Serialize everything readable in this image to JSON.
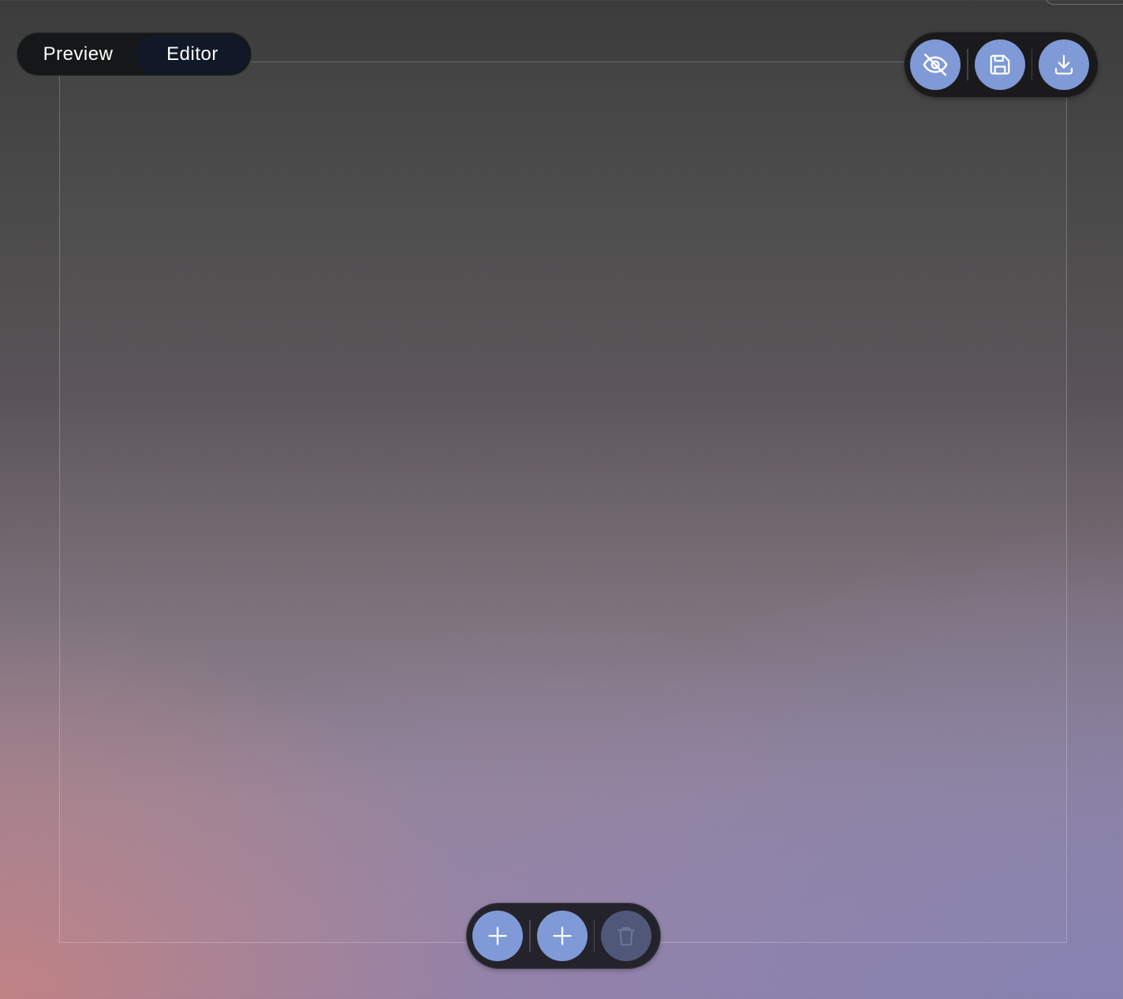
{
  "mode_switch": {
    "tabs": [
      {
        "label": "Preview",
        "active": false
      },
      {
        "label": "Editor",
        "active": true
      }
    ]
  },
  "top_toolbar": {
    "buttons": [
      {
        "icon": "eye-off-icon",
        "name": "toggle-visibility"
      },
      {
        "icon": "save-icon",
        "name": "save"
      },
      {
        "icon": "download-icon",
        "name": "download"
      }
    ]
  },
  "bottom_toolbar": {
    "buttons": [
      {
        "icon": "plus-icon",
        "name": "add",
        "enabled": true
      },
      {
        "icon": "plus-icon",
        "name": "add-second",
        "enabled": true
      },
      {
        "icon": "trash-icon",
        "name": "delete",
        "enabled": false
      }
    ]
  },
  "colors": {
    "accent": "#7f9ad6",
    "disabled": "#4f5878",
    "toolbar_bg": "#1a1a1c"
  }
}
